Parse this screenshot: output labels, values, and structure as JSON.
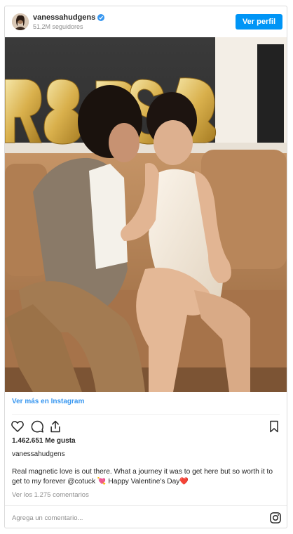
{
  "header": {
    "username": "vanessahudgens",
    "followers": "51,2M seguidores",
    "view_profile_label": "Ver perfil",
    "verified_icon": "verified-badge-icon"
  },
  "photo": {
    "balloon_letters": "R8PS",
    "description_icon": "couple-photo"
  },
  "view_on_instagram": "Ver más en Instagram",
  "actions": {
    "like_icon": "heart-icon",
    "comment_icon": "comment-icon",
    "share_icon": "share-icon",
    "save_icon": "bookmark-icon"
  },
  "likes": "1.462.651 Me gusta",
  "caption": {
    "username": "vanessahudgens",
    "text": "Real magnetic love is out there. What a journey it was to get here but so worth it to get to my forever @cotuck 💘 Happy Valentine's Day❤️"
  },
  "comments_link": "Ver los 1.275 comentarios",
  "add_comment": {
    "placeholder": "Agrega un comentario...",
    "value": ""
  },
  "colors": {
    "accent": "#0095f6",
    "link": "#3897f0",
    "muted": "#8e8e8e",
    "text": "#262626",
    "border": "#dbdbdb"
  }
}
